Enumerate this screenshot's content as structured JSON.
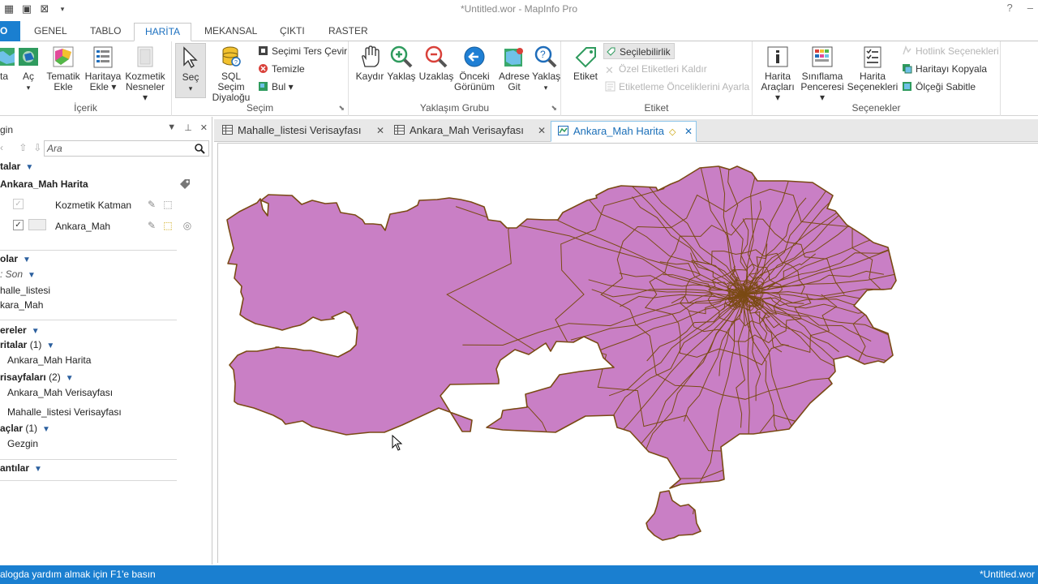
{
  "window": {
    "title": "*Untitled.wor - MapInfo Pro",
    "help": "?",
    "minimize": "–"
  },
  "ribbon_tabs": [
    {
      "label": "O"
    },
    {
      "label": "GENEL"
    },
    {
      "label": "TABLO"
    },
    {
      "label": "HARİTA"
    },
    {
      "label": "MEKANSAL"
    },
    {
      "label": "ÇIKTI"
    },
    {
      "label": "RASTER"
    }
  ],
  "ribbon": {
    "icerik": {
      "label": "İçerik",
      "buttons": [
        {
          "line1": "rta",
          "line2": ""
        },
        {
          "line1": "Aç",
          "line2": "▾"
        },
        {
          "line1": "Tematik",
          "line2": "Ekle"
        },
        {
          "line1": "Haritaya",
          "line2": "Ekle ▾"
        },
        {
          "line1": "Kozmetik",
          "line2": "Nesneler ▾"
        }
      ]
    },
    "secim": {
      "label": "Seçim",
      "sec": "Seç",
      "sec_arrow": "▾",
      "sql_line1": "SQL Seçim",
      "sql_line2": "Diyaloğu",
      "ters_cevir": "Seçimi Ters Çevir",
      "temizle": "Temizle",
      "bul": "Bul ▾"
    },
    "yaklasim": {
      "label": "Yaklaşım Grubu",
      "buttons": [
        {
          "line1": "Kaydır",
          "line2": ""
        },
        {
          "line1": "Yaklaş",
          "line2": ""
        },
        {
          "line1": "Uzaklaş",
          "line2": ""
        },
        {
          "line1": "Önceki",
          "line2": "Görünüm"
        },
        {
          "line1": "Adrese",
          "line2": "Git"
        },
        {
          "line1": "Yaklaş",
          "line2": "▾"
        }
      ]
    },
    "etiket": {
      "label": "Etiket",
      "etiket_btn": "Etiket",
      "secilebilirlik": "Seçilebilirlik",
      "ozel_kaldir": "Özel Etiketleri Kaldır",
      "oncelik": "Etiketleme Önceliklerini Ayarla"
    },
    "secenekler": {
      "label": "Seçenekler",
      "harita_araclari_1": "Harita",
      "harita_araclari_2": "Araçları ▾",
      "siniflama_1": "Sınıflama",
      "siniflama_2": "Penceresi ▾",
      "harita_sec_1": "Harita",
      "harita_sec_2": "Seçenekleri",
      "hotlink": "Hotlink Seçenekleri",
      "kopyala": "Haritayı Kopyala",
      "olcek": "Ölçeği Sabitle"
    }
  },
  "left_panel": {
    "title": "gin",
    "search_placeholder": "Ara",
    "maps_header": "talar",
    "map_name": "Ankara_Mah Harita",
    "layers": [
      {
        "name": "Kozmetik Katman",
        "checked": "✓"
      },
      {
        "name": "Ankara_Mah",
        "checked": "✓"
      }
    ],
    "tables_header": "olar",
    "sort_label": ": Son",
    "tables": [
      "halle_listesi",
      "kara_Mah"
    ],
    "windows_header": "ereler",
    "maps_group": "ritalar",
    "maps_count": "(1)",
    "map_window": "Ankara_Mah Harita",
    "browsers_group": "risayfaları",
    "browsers_count": "(2)",
    "browsers": [
      "Ankara_Mah Verisayfası",
      "Mahalle_listesi Verisayfası"
    ],
    "tools_group": "açlar",
    "tools_count": "(1)",
    "tools": [
      "Gezgin"
    ],
    "connections_header": "antılar"
  },
  "doc_tabs": [
    {
      "label": "Mahalle_listesi Verisayfası",
      "close": "✕"
    },
    {
      "label": "Ankara_Mah Verisayfası",
      "close": "✕"
    },
    {
      "label": "Ankara_Mah Harita",
      "close": "✕",
      "modified": "◇"
    }
  ],
  "map": {
    "fill_color": "#c97fc5",
    "stroke_color": "#7a4a14"
  },
  "status": {
    "left": "alogda yardım almak için F1'e basın",
    "right": "*Untitled.wor"
  },
  "colors": {
    "accent": "#1a7fd0"
  }
}
